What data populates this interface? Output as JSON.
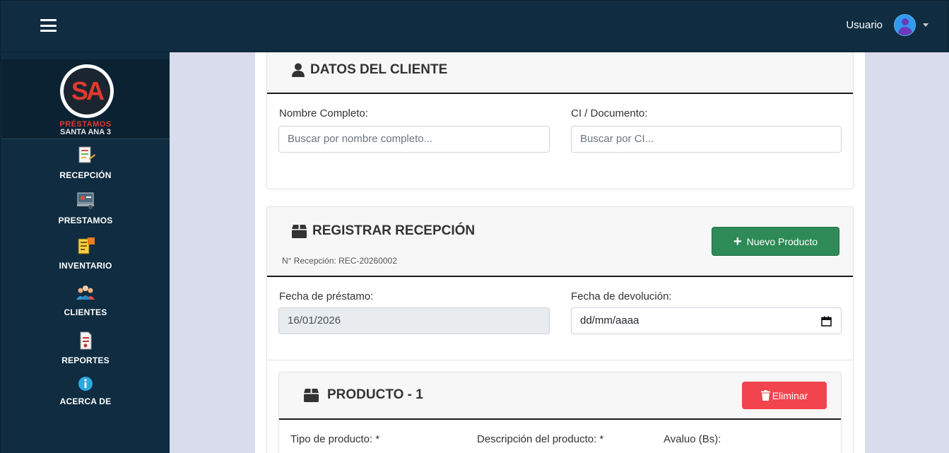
{
  "header": {
    "user_label": "Usuario"
  },
  "brand": {
    "logo_mark": "SA",
    "line1": "PRÉSTAMOS",
    "line2": "SANTA ANA 3"
  },
  "sidebar": {
    "items": [
      {
        "label": "RECEPCIÓN",
        "icon": "reception-icon"
      },
      {
        "label": "PRESTAMOS",
        "icon": "loans-icon"
      },
      {
        "label": "INVENTARIO",
        "icon": "inventory-icon"
      },
      {
        "label": "CLIENTES",
        "icon": "clients-icon"
      },
      {
        "label": "REPORTES",
        "icon": "reports-icon"
      },
      {
        "label": "ACERCA DE",
        "icon": "info-icon"
      }
    ]
  },
  "client": {
    "title": "DATOS DEL CLIENTE",
    "name_label": "Nombre Completo:",
    "name_placeholder": "Buscar por nombre completo...",
    "doc_label": "CI / Documento:",
    "doc_placeholder": "Buscar por CI..."
  },
  "reception": {
    "title": "REGISTRAR RECEPCIÓN",
    "number_text": "N° Recepción: REC-20260002",
    "new_product_button": "Nuevo Producto",
    "loan_date_label": "Fecha de préstamo:",
    "loan_date_value": "16/01/2026",
    "return_date_label": "Fecha de devolución:",
    "return_date_placeholder": "dd/mm/aaaa"
  },
  "product": {
    "title": "PRODUCTO - 1",
    "delete_button": "Eliminar",
    "type_label": "Tipo de producto: *",
    "description_label": "Descripción del producto: *",
    "appraisal_label": "Avaluo (Bs):"
  },
  "colors": {
    "navy": "#0f2c40",
    "success": "#2e8b57",
    "danger": "#f2444f",
    "brand_red": "#e03a2f"
  }
}
